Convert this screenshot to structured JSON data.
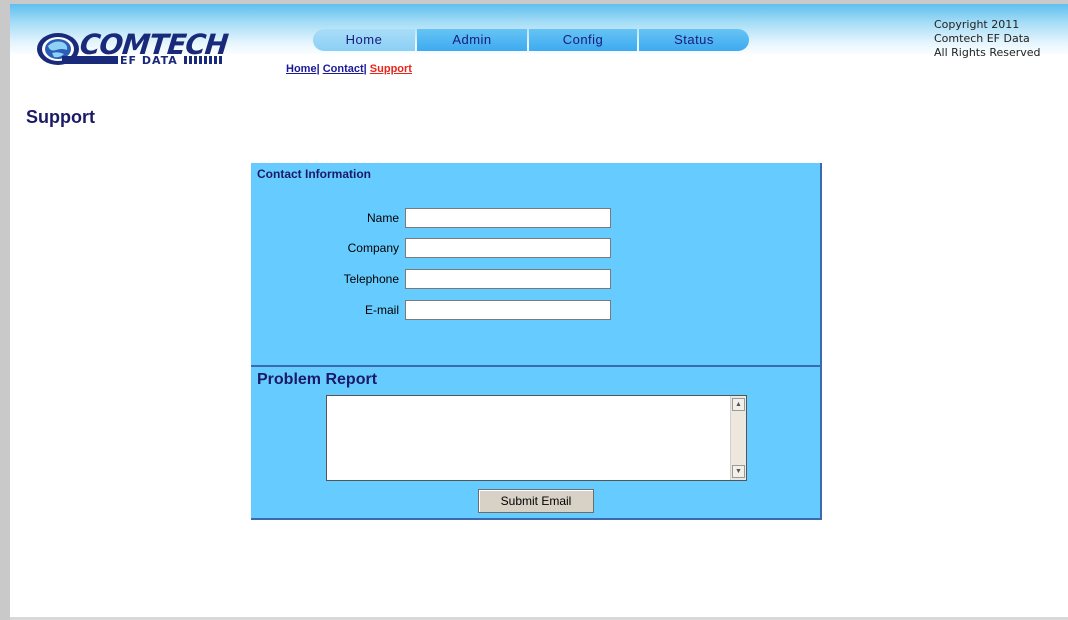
{
  "header": {
    "logo": {
      "brand": "COMTECH",
      "sub": "EF DATA"
    },
    "nav_tabs": [
      {
        "label": "Home"
      },
      {
        "label": "Admin"
      },
      {
        "label": "Config"
      },
      {
        "label": "Status"
      }
    ],
    "subnav": {
      "home": "Home",
      "contact": "Contact",
      "support": "Support",
      "separator": "|"
    },
    "copyright": {
      "line1": "Copyright 2011",
      "line2": "Comtech EF Data",
      "line3": "All Rights Reserved"
    }
  },
  "page": {
    "title": "Support"
  },
  "contact": {
    "title": "Contact Information",
    "fields": {
      "name": {
        "label": "Name",
        "value": ""
      },
      "company": {
        "label": "Company",
        "value": ""
      },
      "telephone": {
        "label": "Telephone",
        "value": ""
      },
      "email": {
        "label": "E-mail",
        "value": ""
      }
    }
  },
  "problem": {
    "title": "Problem Report",
    "value": "",
    "submit_label": "Submit Email"
  },
  "colors": {
    "panel": "#66ccff",
    "heading": "#1a1a66",
    "active_link": "#e8251b",
    "tab": "#3eaaf0"
  }
}
